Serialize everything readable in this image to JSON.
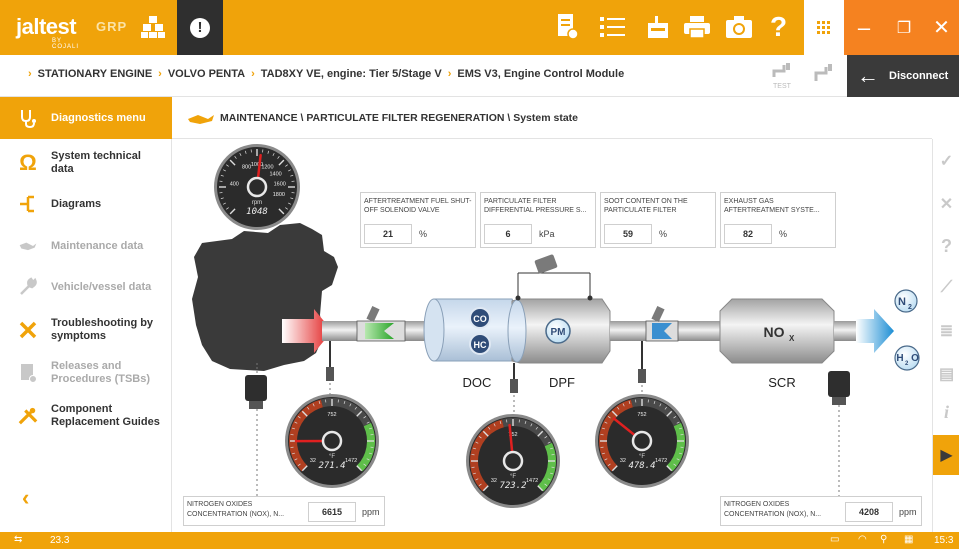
{
  "app": {
    "logo_text": "jaltest",
    "logo_sub": "BY COJALI",
    "edition": "GRP",
    "accent_color": "#f0a30a",
    "dark_color": "#2f2f2f",
    "window_color": "#f58220"
  },
  "toolbar": {
    "icons": [
      "report-icon",
      "checklist-icon",
      "garage-icon",
      "printer-icon",
      "camera-icon",
      "help-icon",
      "grid-icon",
      "alert-icon"
    ],
    "help_label": "?"
  },
  "window": {
    "minimize": "–",
    "restore": "❐",
    "close": "✕"
  },
  "breadcrumb": [
    "STATIONARY ENGINE",
    "VOLVO PENTA",
    "TAD8XY VE, engine: Tier 5/Stage V",
    "EMS V3, Engine Control Module"
  ],
  "breadcrumb_extra": {
    "test_label": "TEST",
    "disconnect_label": "Disconnect"
  },
  "sidebar": {
    "items": [
      {
        "label": "Diagnostics menu",
        "active": true,
        "enabled": true
      },
      {
        "label": "System technical data",
        "active": false,
        "enabled": true
      },
      {
        "label": "Diagrams",
        "active": false,
        "enabled": true
      },
      {
        "label": "Maintenance data",
        "active": false,
        "enabled": false
      },
      {
        "label": "Vehicle/vessel data",
        "active": false,
        "enabled": false
      },
      {
        "label": "Troubleshooting by symptoms",
        "active": false,
        "enabled": true
      },
      {
        "label": "Releases and Procedures (TSBs)",
        "active": false,
        "enabled": false
      },
      {
        "label": "Component Replacement Guides",
        "active": false,
        "enabled": true
      }
    ],
    "back_label": "‹"
  },
  "main": {
    "path": "MAINTENANCE \\ PARTICULATE FILTER REGENERATION \\ System state"
  },
  "params": [
    {
      "name": "AFTERTREATMENT FUEL SHUT-OFF SOLENOID VALVE",
      "value": "21",
      "unit": "%"
    },
    {
      "name": "PARTICULATE FILTER DIFFERENTIAL PRESSURE S...",
      "value": "6",
      "unit": "kPa"
    },
    {
      "name": "SOOT CONTENT ON THE PARTICULATE FILTER",
      "value": "59",
      "unit": "%"
    },
    {
      "name": "EXHAUST GAS AFTERTREATMENT SYSTE...",
      "value": "82",
      "unit": "%"
    }
  ],
  "nox": [
    {
      "name": "NITROGEN OXIDES CONCENTRATION (NOX), N...",
      "value": "6615",
      "unit": "ppm"
    },
    {
      "name": "NITROGEN OXIDES CONCENTRATION (NOX), N...",
      "value": "4208",
      "unit": "ppm"
    }
  ],
  "gauges": {
    "rpm": {
      "unit": "rpm",
      "reading": "1048",
      "value": 1048,
      "min": 0,
      "max": 2000,
      "ticks": [
        "400",
        "800",
        "1000",
        "1200",
        "1400",
        "1600",
        "1800"
      ]
    },
    "temps": [
      {
        "reading": "271.4",
        "value": 271.4,
        "min": 32,
        "max": 1472,
        "unit": "°F",
        "ticks": [
          "32",
          "752",
          "1472"
        ]
      },
      {
        "reading": "723.2",
        "value": 723.2,
        "min": 32,
        "max": 1472,
        "unit": "°F",
        "ticks": [
          "32",
          "752",
          "1472"
        ]
      },
      {
        "reading": "478.4",
        "value": 478.4,
        "min": 32,
        "max": 1472,
        "unit": "°F",
        "ticks": [
          "32",
          "752",
          "1472"
        ]
      }
    ]
  },
  "diagram": {
    "doc_label": "DOC",
    "dpf_label": "DPF",
    "scr_label": "SCR",
    "co": "CO",
    "hc": "HC",
    "pm": "PM",
    "nox_main": "NO",
    "nox_sub": "X",
    "n2_main": "N",
    "n2_sub": "2",
    "h2o_h": "H",
    "h2o_sub": "2",
    "h2o_o": "O"
  },
  "statusbar": {
    "version": "23.3",
    "clock": "15:3"
  }
}
